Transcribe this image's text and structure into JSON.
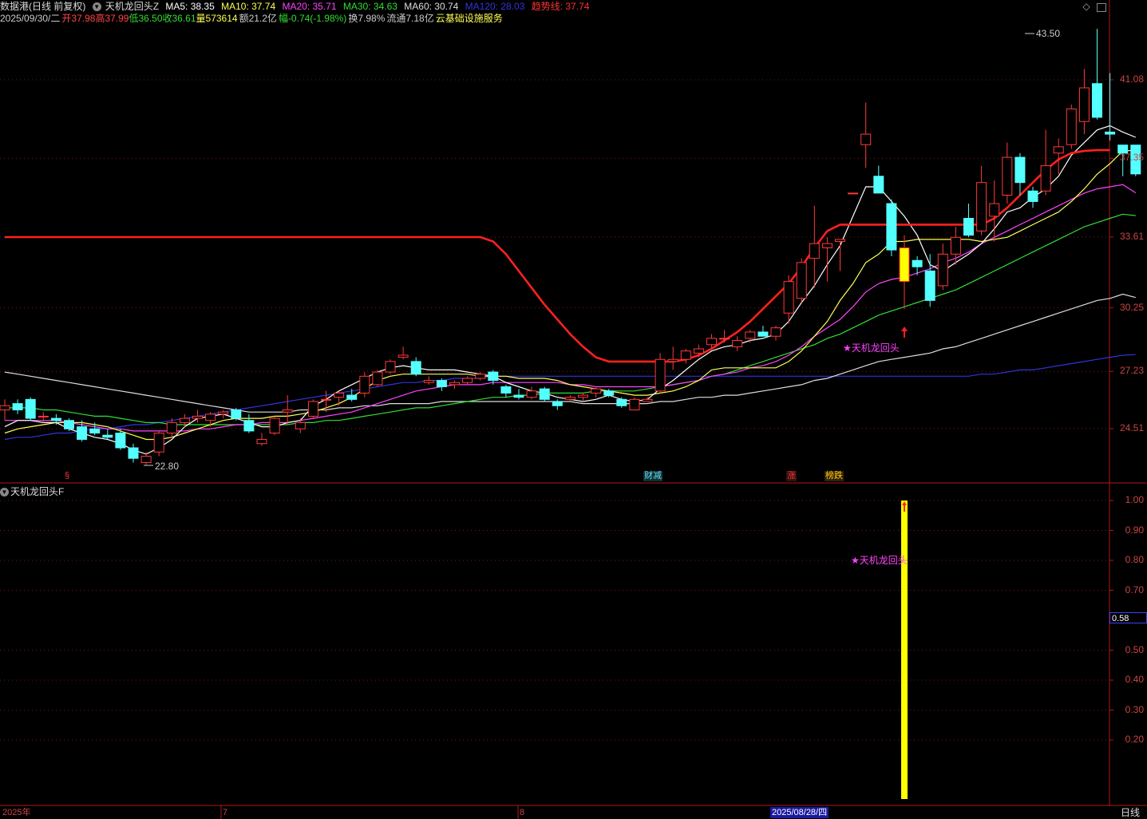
{
  "header": {
    "stock_name": "数据港",
    "mode": "(日线 前复权)",
    "indicator": "天机龙回头Z",
    "ma5": "MA5: 38.35",
    "ma10": "MA10: 37.74",
    "ma20": "MA20: 35.71",
    "ma30": "MA30: 34.63",
    "ma60": "MA60: 30.74",
    "ma120": "MA120: 28.03",
    "trend": "趋势线: 37.74"
  },
  "quote": {
    "date": "2025/09/30/二",
    "open": "开37.98",
    "high": "高37.99",
    "low": "低36.50",
    "close": "收36.61",
    "volume": "量573614",
    "amount": "额21.2亿",
    "change": "幅-0.74(-1.98%)",
    "turnover": "换7.98%",
    "float": "流通7.18亿",
    "sector": "云基础设施服务"
  },
  "colors": {
    "up": "#ff3a3a",
    "down": "#54ffff",
    "ma5": "#ffffff",
    "ma10": "#ffff55",
    "ma20": "#ff44ff",
    "ma30": "#33dd33",
    "ma60": "#dddddd",
    "ma120": "#3333dd",
    "trend": "#ff2020",
    "signal": "#ffff00"
  },
  "main_axis": [
    "41.08",
    "37.35",
    "33.61",
    "30.25",
    "27.23",
    "24.51"
  ],
  "sub_axis": [
    "1.00",
    "0.90",
    "0.80",
    "0.70",
    "0.50",
    "0.40",
    "0.30",
    "0.20"
  ],
  "sub_current": "0.58",
  "annotations": {
    "high_label": "43.50",
    "low_label": "22.80",
    "signal_label": "★天机龙回头",
    "sub_signal_label": "★天机龙回头",
    "sub_title": "天机龙回头F"
  },
  "markers": [
    {
      "text": "§",
      "color": "#ff3333"
    },
    {
      "text": "财减",
      "color": "#66ddff"
    },
    {
      "text": "涨",
      "color": "#ff3333"
    },
    {
      "text": "榜跌",
      "color": "#ffcc00"
    }
  ],
  "x_axis": {
    "year": "2025年",
    "m7": "7",
    "m8": "8",
    "selected_date": "2025/08/28/四",
    "period": "日线"
  },
  "chart_data": {
    "type": "candlestick",
    "candles": [
      {
        "o": 25.4,
        "h": 25.9,
        "l": 24.9,
        "c": 25.6
      },
      {
        "o": 25.7,
        "h": 25.9,
        "l": 25.2,
        "c": 25.4
      },
      {
        "o": 25.9,
        "h": 26.0,
        "l": 24.9,
        "c": 25.0
      },
      {
        "o": 25.1,
        "h": 25.3,
        "l": 24.8,
        "c": 25.1
      },
      {
        "o": 25.0,
        "h": 25.2,
        "l": 24.7,
        "c": 24.9
      },
      {
        "o": 24.9,
        "h": 25.0,
        "l": 24.4,
        "c": 24.5
      },
      {
        "o": 24.6,
        "h": 24.9,
        "l": 23.9,
        "c": 24.0
      },
      {
        "o": 24.5,
        "h": 24.8,
        "l": 24.2,
        "c": 24.3
      },
      {
        "o": 24.2,
        "h": 24.5,
        "l": 24.0,
        "c": 24.1
      },
      {
        "o": 24.3,
        "h": 24.5,
        "l": 23.5,
        "c": 23.6
      },
      {
        "o": 23.6,
        "h": 23.8,
        "l": 22.9,
        "c": 23.1
      },
      {
        "o": 22.9,
        "h": 23.4,
        "l": 22.8,
        "c": 23.2
      },
      {
        "o": 23.4,
        "h": 24.4,
        "l": 23.2,
        "c": 24.3
      },
      {
        "o": 24.3,
        "h": 25.0,
        "l": 24.1,
        "c": 24.8
      },
      {
        "o": 24.8,
        "h": 25.2,
        "l": 24.6,
        "c": 25.0
      },
      {
        "o": 25.0,
        "h": 25.4,
        "l": 24.8,
        "c": 25.1
      },
      {
        "o": 24.9,
        "h": 25.3,
        "l": 24.6,
        "c": 25.2
      },
      {
        "o": 25.2,
        "h": 25.4,
        "l": 25.0,
        "c": 25.3
      },
      {
        "o": 25.4,
        "h": 25.5,
        "l": 24.9,
        "c": 25.0
      },
      {
        "o": 24.9,
        "h": 25.2,
        "l": 24.3,
        "c": 24.4
      },
      {
        "o": 23.8,
        "h": 24.3,
        "l": 23.7,
        "c": 24.0
      },
      {
        "o": 24.3,
        "h": 25.1,
        "l": 24.2,
        "c": 25.0
      },
      {
        "o": 25.3,
        "h": 26.1,
        "l": 24.7,
        "c": 25.4
      },
      {
        "o": 24.5,
        "h": 25.0,
        "l": 24.3,
        "c": 24.8
      },
      {
        "o": 25.1,
        "h": 25.9,
        "l": 25.0,
        "c": 25.8
      },
      {
        "o": 25.9,
        "h": 26.3,
        "l": 25.3,
        "c": 25.9
      },
      {
        "o": 26.0,
        "h": 26.3,
        "l": 25.6,
        "c": 26.2
      },
      {
        "o": 26.1,
        "h": 26.4,
        "l": 25.8,
        "c": 25.9
      },
      {
        "o": 26.2,
        "h": 27.2,
        "l": 26.0,
        "c": 27.0
      },
      {
        "o": 26.6,
        "h": 27.3,
        "l": 26.5,
        "c": 27.2
      },
      {
        "o": 27.2,
        "h": 27.8,
        "l": 27.1,
        "c": 27.7
      },
      {
        "o": 27.9,
        "h": 28.4,
        "l": 27.8,
        "c": 28.0
      },
      {
        "o": 27.7,
        "h": 27.9,
        "l": 27.0,
        "c": 27.1
      },
      {
        "o": 26.7,
        "h": 27.0,
        "l": 26.6,
        "c": 26.8
      },
      {
        "o": 26.8,
        "h": 26.9,
        "l": 26.3,
        "c": 26.5
      },
      {
        "o": 26.6,
        "h": 26.8,
        "l": 26.4,
        "c": 26.7
      },
      {
        "o": 26.7,
        "h": 27.0,
        "l": 26.6,
        "c": 26.9
      },
      {
        "o": 26.9,
        "h": 27.2,
        "l": 26.8,
        "c": 27.1
      },
      {
        "o": 27.2,
        "h": 27.3,
        "l": 26.6,
        "c": 26.8
      },
      {
        "o": 26.5,
        "h": 26.6,
        "l": 26.0,
        "c": 26.2
      },
      {
        "o": 26.1,
        "h": 26.4,
        "l": 25.9,
        "c": 26.0
      },
      {
        "o": 26.0,
        "h": 26.5,
        "l": 25.9,
        "c": 26.3
      },
      {
        "o": 26.4,
        "h": 26.5,
        "l": 25.8,
        "c": 25.9
      },
      {
        "o": 25.8,
        "h": 25.9,
        "l": 25.4,
        "c": 25.6
      },
      {
        "o": 25.9,
        "h": 26.1,
        "l": 25.8,
        "c": 26.0
      },
      {
        "o": 26.0,
        "h": 26.2,
        "l": 25.8,
        "c": 26.1
      },
      {
        "o": 26.2,
        "h": 26.5,
        "l": 26.0,
        "c": 26.4
      },
      {
        "o": 26.3,
        "h": 26.4,
        "l": 26.0,
        "c": 26.1
      },
      {
        "o": 25.9,
        "h": 26.0,
        "l": 25.5,
        "c": 25.6
      },
      {
        "o": 25.4,
        "h": 26.0,
        "l": 25.4,
        "c": 25.9
      },
      {
        "o": 25.8,
        "h": 26.0,
        "l": 25.8,
        "c": 25.9
      },
      {
        "o": 26.3,
        "h": 28.1,
        "l": 26.2,
        "c": 27.8
      },
      {
        "o": 27.7,
        "h": 28.4,
        "l": 27.3,
        "c": 27.8
      },
      {
        "o": 27.8,
        "h": 28.3,
        "l": 27.6,
        "c": 28.2
      },
      {
        "o": 28.1,
        "h": 28.5,
        "l": 27.9,
        "c": 28.3
      },
      {
        "o": 28.5,
        "h": 29.0,
        "l": 28.3,
        "c": 28.8
      },
      {
        "o": 28.8,
        "h": 29.2,
        "l": 28.6,
        "c": 28.8
      },
      {
        "o": 28.4,
        "h": 28.9,
        "l": 28.2,
        "c": 28.7
      },
      {
        "o": 28.8,
        "h": 29.2,
        "l": 28.6,
        "c": 29.1
      },
      {
        "o": 29.1,
        "h": 29.4,
        "l": 28.9,
        "c": 28.9
      },
      {
        "o": 28.9,
        "h": 29.4,
        "l": 28.7,
        "c": 29.3
      },
      {
        "o": 30.0,
        "h": 31.8,
        "l": 29.5,
        "c": 31.5
      },
      {
        "o": 30.7,
        "h": 32.6,
        "l": 30.5,
        "c": 32.4
      },
      {
        "o": 32.6,
        "h": 35.1,
        "l": 31.2,
        "c": 33.3
      },
      {
        "o": 33.1,
        "h": 33.6,
        "l": 31.5,
        "c": 33.3
      },
      {
        "o": 33.4,
        "h": 33.5,
        "l": 32.0,
        "c": 33.5
      },
      {
        "o": 35.7,
        "h": 35.7,
        "l": 35.7,
        "c": 35.7
      },
      {
        "o": 38.0,
        "h": 40.0,
        "l": 36.9,
        "c": 38.5
      },
      {
        "o": 36.5,
        "h": 37.0,
        "l": 35.9,
        "c": 35.7
      },
      {
        "o": 35.2,
        "h": 35.4,
        "l": 32.7,
        "c": 33.0
      },
      {
        "o": 31.5,
        "h": 33.7,
        "l": 30.2,
        "c": 33.1
      },
      {
        "o": 32.5,
        "h": 32.7,
        "l": 31.8,
        "c": 32.2
      },
      {
        "o": 32.0,
        "h": 32.8,
        "l": 30.3,
        "c": 30.6
      },
      {
        "o": 31.3,
        "h": 33.3,
        "l": 31.1,
        "c": 32.8
      },
      {
        "o": 32.8,
        "h": 34.1,
        "l": 32.3,
        "c": 33.6
      },
      {
        "o": 34.5,
        "h": 35.2,
        "l": 33.6,
        "c": 33.7
      },
      {
        "o": 33.9,
        "h": 37.0,
        "l": 33.7,
        "c": 36.2
      },
      {
        "o": 34.6,
        "h": 36.3,
        "l": 33.4,
        "c": 35.2
      },
      {
        "o": 35.6,
        "h": 38.1,
        "l": 35.2,
        "c": 37.4
      },
      {
        "o": 37.4,
        "h": 37.6,
        "l": 35.6,
        "c": 36.2
      },
      {
        "o": 35.8,
        "h": 36.0,
        "l": 35.0,
        "c": 35.3
      },
      {
        "o": 35.8,
        "h": 38.7,
        "l": 35.6,
        "c": 37.0
      },
      {
        "o": 37.6,
        "h": 38.3,
        "l": 36.6,
        "c": 37.9
      },
      {
        "o": 38.0,
        "h": 39.9,
        "l": 37.8,
        "c": 39.7
      },
      {
        "o": 39.1,
        "h": 41.6,
        "l": 38.5,
        "c": 40.7
      },
      {
        "o": 40.9,
        "h": 43.5,
        "l": 39.2,
        "c": 39.3
      },
      {
        "o": 38.6,
        "h": 41.4,
        "l": 38.2,
        "c": 38.5
      },
      {
        "o": 37.98,
        "h": 37.99,
        "l": 36.5,
        "c": 37.6
      },
      {
        "o": 37.98,
        "h": 37.99,
        "l": 36.5,
        "c": 36.61
      }
    ],
    "ma5": [
      24.6,
      24.9,
      24.9,
      24.8,
      24.8,
      24.5,
      24.3,
      24.1,
      24.0,
      23.8,
      23.5,
      23.3,
      23.6,
      24.0,
      24.6,
      25.0,
      25.1,
      25.2,
      25.0,
      24.8,
      24.6,
      24.6,
      24.8,
      24.9,
      25.6,
      25.9,
      26.3,
      26.6,
      26.9,
      27.2,
      27.4,
      27.5,
      27.4,
      27.3,
      27.3,
      27.3,
      27.2,
      27.1,
      27.0,
      26.7,
      26.5,
      26.3,
      26.2,
      26.0,
      25.9,
      25.8,
      25.9,
      26.1,
      25.9,
      25.8,
      25.9,
      26.4,
      26.8,
      27.3,
      27.8,
      28.2,
      28.4,
      28.5,
      28.7,
      28.8,
      29.0,
      29.6,
      30.5,
      31.3,
      32.3,
      33.2,
      34.6,
      36.0,
      36.0,
      35.3,
      34.6,
      33.7,
      32.3,
      32.0,
      32.4,
      32.8,
      33.3,
      34.0,
      34.8,
      35.0,
      35.5,
      35.9,
      36.5,
      37.5,
      38.1,
      38.7,
      38.9,
      38.6,
      38.35
    ],
    "ma10": [
      24.3,
      24.5,
      24.6,
      24.7,
      24.8,
      24.8,
      24.8,
      24.7,
      24.6,
      24.4,
      24.2,
      24.0,
      24.0,
      24.1,
      24.3,
      24.5,
      24.7,
      24.9,
      25.0,
      25.0,
      25.0,
      25.1,
      25.1,
      25.2,
      25.3,
      25.5,
      25.7,
      26.0,
      26.4,
      26.8,
      27.0,
      27.1,
      27.1,
      27.1,
      27.1,
      27.1,
      27.1,
      27.0,
      27.0,
      27.0,
      26.9,
      26.9,
      26.9,
      26.8,
      26.6,
      26.5,
      26.4,
      26.3,
      26.2,
      26.1,
      26.1,
      26.2,
      26.3,
      26.5,
      26.8,
      27.3,
      27.4,
      27.4,
      27.4,
      27.4,
      27.4,
      27.7,
      28.2,
      28.9,
      29.6,
      30.6,
      31.4,
      32.4,
      32.8,
      33.4,
      33.4,
      33.5,
      33.5,
      33.5,
      33.5,
      33.5,
      33.4,
      33.5,
      33.6,
      33.9,
      34.2,
      34.5,
      34.8,
      35.3,
      35.9,
      36.6,
      37.1,
      37.7,
      37.74
    ],
    "ma20": [
      24.9,
      24.9,
      24.9,
      24.9,
      24.9,
      24.8,
      24.7,
      24.6,
      24.5,
      24.5,
      24.4,
      24.4,
      24.4,
      24.4,
      24.4,
      24.5,
      24.5,
      24.6,
      24.7,
      24.7,
      24.8,
      24.8,
      24.8,
      24.9,
      25.0,
      25.1,
      25.2,
      25.3,
      25.5,
      25.7,
      25.9,
      26.1,
      26.3,
      26.4,
      26.5,
      26.6,
      26.6,
      26.6,
      26.7,
      26.7,
      26.7,
      26.7,
      26.7,
      26.7,
      26.6,
      26.6,
      26.5,
      26.5,
      26.5,
      26.5,
      26.5,
      26.5,
      26.6,
      26.7,
      26.8,
      27.0,
      27.1,
      27.2,
      27.4,
      27.5,
      27.7,
      28.0,
      28.4,
      28.9,
      29.3,
      29.7,
      30.3,
      31.0,
      31.4,
      31.6,
      31.7,
      31.9,
      32.1,
      32.4,
      32.6,
      32.9,
      33.3,
      33.6,
      33.9,
      34.2,
      34.5,
      34.8,
      35.1,
      35.4,
      35.7,
      35.9,
      36.0,
      36.1,
      35.71
    ],
    "ma30": [
      25.5,
      25.5,
      25.5,
      25.4,
      25.4,
      25.3,
      25.2,
      25.1,
      25.1,
      25.0,
      24.9,
      24.8,
      24.8,
      24.7,
      24.7,
      24.7,
      24.7,
      24.7,
      24.7,
      24.7,
      24.7,
      24.7,
      24.7,
      24.8,
      24.8,
      24.9,
      24.9,
      25.0,
      25.1,
      25.2,
      25.3,
      25.4,
      25.5,
      25.5,
      25.6,
      25.7,
      25.8,
      25.9,
      26.0,
      26.0,
      26.1,
      26.1,
      26.2,
      26.2,
      26.2,
      26.2,
      26.3,
      26.3,
      26.3,
      26.3,
      26.4,
      26.5,
      26.6,
      26.7,
      26.8,
      27.0,
      27.1,
      27.3,
      27.5,
      27.7,
      27.9,
      28.1,
      28.3,
      28.5,
      28.8,
      29.0,
      29.3,
      29.6,
      29.9,
      30.1,
      30.3,
      30.5,
      30.7,
      30.9,
      31.1,
      31.4,
      31.7,
      32.0,
      32.3,
      32.6,
      32.9,
      33.2,
      33.5,
      33.8,
      34.1,
      34.3,
      34.5,
      34.7,
      34.63
    ],
    "ma60": [
      27.2,
      27.1,
      27.0,
      26.9,
      26.8,
      26.7,
      26.6,
      26.5,
      26.4,
      26.3,
      26.2,
      26.1,
      26.0,
      25.9,
      25.8,
      25.7,
      25.6,
      25.5,
      25.4,
      25.3,
      25.3,
      25.3,
      25.3,
      25.4,
      25.4,
      25.4,
      25.5,
      25.5,
      25.6,
      25.6,
      25.7,
      25.7,
      25.7,
      25.7,
      25.8,
      25.8,
      25.8,
      25.8,
      25.8,
      25.8,
      25.8,
      25.8,
      25.8,
      25.8,
      25.8,
      25.7,
      25.7,
      25.7,
      25.7,
      25.7,
      25.7,
      25.8,
      25.8,
      25.9,
      26.0,
      26.0,
      26.1,
      26.1,
      26.2,
      26.3,
      26.4,
      26.5,
      26.6,
      26.8,
      26.9,
      27.1,
      27.3,
      27.5,
      27.7,
      27.8,
      27.9,
      28.0,
      28.1,
      28.3,
      28.4,
      28.6,
      28.8,
      29.0,
      29.2,
      29.4,
      29.6,
      29.8,
      30.0,
      30.2,
      30.4,
      30.6,
      30.7,
      30.9,
      30.74
    ],
    "ma120": [
      24.0,
      24.1,
      24.1,
      24.2,
      24.3,
      24.3,
      24.4,
      24.5,
      24.5,
      24.6,
      24.7,
      24.7,
      24.8,
      24.9,
      25.0,
      25.1,
      25.2,
      25.3,
      25.4,
      25.5,
      25.6,
      25.7,
      25.8,
      25.9,
      26.0,
      26.1,
      26.2,
      26.3,
      26.4,
      26.5,
      26.6,
      26.7,
      26.7,
      26.8,
      26.8,
      26.9,
      26.9,
      26.9,
      27.0,
      27.0,
      27.0,
      27.0,
      27.0,
      27.0,
      27.0,
      27.0,
      27.0,
      27.0,
      27.0,
      27.0,
      27.0,
      27.0,
      27.0,
      27.0,
      27.0,
      27.0,
      27.0,
      27.0,
      27.0,
      27.0,
      27.0,
      27.0,
      27.0,
      27.0,
      27.0,
      27.0,
      27.0,
      27.0,
      27.0,
      27.0,
      27.0,
      27.0,
      27.0,
      27.0,
      27.0,
      27.0,
      27.1,
      27.1,
      27.2,
      27.3,
      27.3,
      27.4,
      27.5,
      27.6,
      27.7,
      27.8,
      27.9,
      28.0,
      28.03
    ],
    "trend": [
      33.61,
      33.61,
      33.61,
      33.61,
      33.61,
      33.61,
      33.61,
      33.61,
      33.61,
      33.61,
      33.61,
      33.61,
      33.61,
      33.61,
      33.61,
      33.61,
      33.61,
      33.61,
      33.61,
      33.61,
      33.61,
      33.61,
      33.61,
      33.61,
      33.61,
      33.61,
      33.61,
      33.61,
      33.61,
      33.61,
      33.61,
      33.61,
      33.61,
      33.61,
      33.61,
      33.61,
      33.61,
      33.61,
      33.4,
      32.8,
      32.0,
      31.2,
      30.4,
      29.7,
      29.0,
      28.4,
      27.9,
      27.7,
      27.7,
      27.7,
      27.7,
      27.7,
      27.7,
      27.8,
      28.0,
      28.3,
      28.7,
      29.1,
      29.6,
      30.2,
      30.8,
      31.4,
      32.2,
      33.1,
      33.9,
      34.2,
      34.2,
      34.2,
      34.2,
      34.2,
      34.2,
      34.2,
      34.2,
      34.2,
      34.2,
      34.2,
      34.2,
      34.5,
      35.0,
      35.6,
      36.2,
      36.8,
      37.3,
      37.6,
      37.7,
      37.74,
      37.74
    ],
    "signal_index": 70,
    "y_range": [
      22.0,
      45.0
    ],
    "sub_range": [
      0,
      1.0
    ]
  }
}
